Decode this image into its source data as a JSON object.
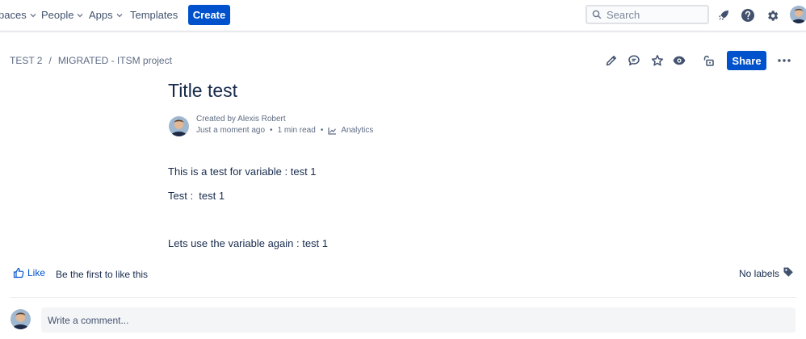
{
  "topnav": {
    "items": [
      {
        "label": "paces"
      },
      {
        "label": "People"
      },
      {
        "label": "Apps"
      },
      {
        "label": "Templates"
      }
    ],
    "create_label": "Create",
    "search_placeholder": "Search",
    "icons": [
      "rocket-icon",
      "help-icon",
      "settings-icon"
    ]
  },
  "page": {
    "breadcrumb": [
      "TEST 2",
      "MIGRATED - ITSM project"
    ],
    "breadcrumb_separator": "/",
    "share_label": "Share",
    "title": "Title test",
    "byline": {
      "created": "Created by Alexis Robert",
      "time": "Just a moment ago",
      "read": "1 min read",
      "dot": "•",
      "analytics": "Analytics"
    },
    "paragraphs": [
      "This is a test for variable : test 1",
      "Test :  test 1",
      "Lets use the variable again : test 1"
    ]
  },
  "footer": {
    "like_label": "Like",
    "like_prompt": "Be the first to like this",
    "labels_text": "No labels",
    "comment_placeholder": "Write a comment..."
  },
  "colors": {
    "brand_blue": "#0052cc",
    "text_primary": "#172b4d",
    "text_secondary": "#5e6c84"
  }
}
